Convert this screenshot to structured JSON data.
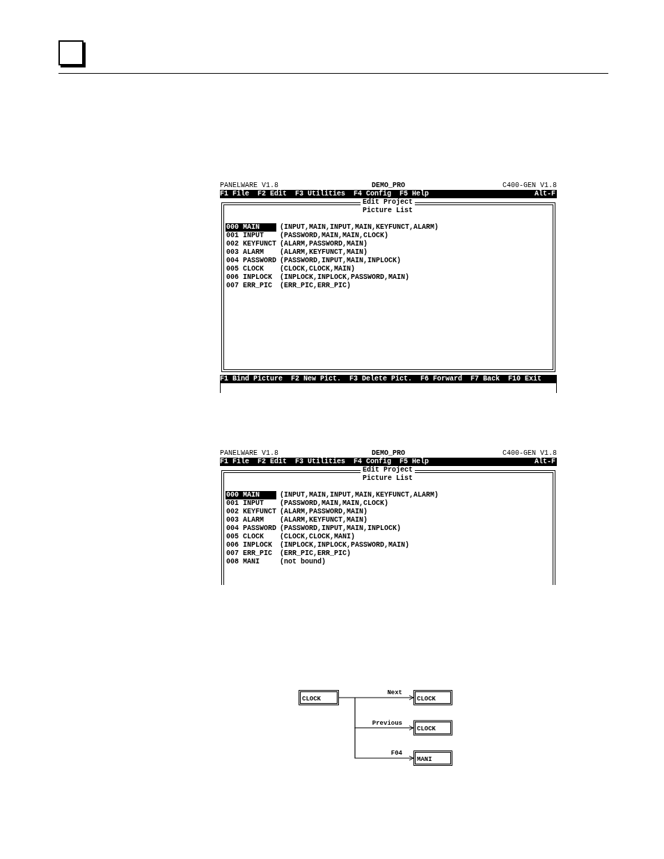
{
  "screens": [
    {
      "title": "PANELWARE V1.8",
      "project": "DEMO_PRO",
      "version": "C400-GEN V1.8",
      "menu": [
        "F1 File",
        "F2 Edit",
        "F3 Utilities",
        "F4 Config",
        "F5 Help"
      ],
      "menu_shortcut": "Alt-F",
      "frame_title": "Edit Project",
      "list_title": "Picture List",
      "pictures": [
        {
          "number": "000",
          "name": "MAIN",
          "links": "(INPUT,MAIN,INPUT,MAIN,KEYFUNCT,ALARM)",
          "selected": true
        },
        {
          "number": "001",
          "name": "INPUT",
          "links": "(PASSWORD,MAIN,MAIN,CLOCK)",
          "selected": false
        },
        {
          "number": "002",
          "name": "KEYFUNCT",
          "links": "(ALARM,PASSWORD,MAIN)",
          "selected": false
        },
        {
          "number": "003",
          "name": "ALARM",
          "links": "(ALARM,KEYFUNCT,MAIN)",
          "selected": false
        },
        {
          "number": "004",
          "name": "PASSWORD",
          "links": "(PASSWORD,INPUT,MAIN,INPLOCK)",
          "selected": false
        },
        {
          "number": "005",
          "name": "CLOCK",
          "links": "(CLOCK,CLOCK,MAIN)",
          "selected": false
        },
        {
          "number": "006",
          "name": "INPLOCK",
          "links": "(INPLOCK,INPLOCK,PASSWORD,MAIN)",
          "selected": false
        },
        {
          "number": "007",
          "name": "ERR_PIC",
          "links": "(ERR_PIC,ERR_PIC)",
          "selected": false
        }
      ],
      "function_keys": [
        "F1 Bind Picture",
        "F2 New Pict.",
        "F3 Delete Pict.",
        "F6 Forward",
        "F7 Back",
        "F10 Exit"
      ]
    },
    {
      "title": "PANELWARE V1.8",
      "project": "DEMO_PRO",
      "version": "C400-GEN V1.8",
      "menu": [
        "F1 File",
        "F2 Edit",
        "F3 Utilities",
        "F4 Config",
        "F5 Help"
      ],
      "menu_shortcut": "Alt-F",
      "frame_title": "Edit Project",
      "list_title": "Picture List",
      "pictures": [
        {
          "number": "000",
          "name": "MAIN",
          "links": "(INPUT,MAIN,INPUT,MAIN,KEYFUNCT,ALARM)",
          "selected": true
        },
        {
          "number": "001",
          "name": "INPUT",
          "links": "(PASSWORD,MAIN,MAIN,CLOCK)",
          "selected": false
        },
        {
          "number": "002",
          "name": "KEYFUNCT",
          "links": "(ALARM,PASSWORD,MAIN)",
          "selected": false
        },
        {
          "number": "003",
          "name": "ALARM",
          "links": "(ALARM,KEYFUNCT,MAIN)",
          "selected": false
        },
        {
          "number": "004",
          "name": "PASSWORD",
          "links": "(PASSWORD,INPUT,MAIN,INPLOCK)",
          "selected": false
        },
        {
          "number": "005",
          "name": "CLOCK",
          "links": "(CLOCK,CLOCK,MANI)",
          "selected": false
        },
        {
          "number": "006",
          "name": "INPLOCK",
          "links": "(INPLOCK,INPLOCK,PASSWORD,MAIN)",
          "selected": false
        },
        {
          "number": "007",
          "name": "ERR_PIC",
          "links": "(ERR_PIC,ERR_PIC)",
          "selected": false
        },
        {
          "number": "008",
          "name": "MANI",
          "links": "(not bound)",
          "selected": false
        }
      ]
    }
  ],
  "diagram": {
    "source": "CLOCK",
    "links": [
      {
        "label": "Next",
        "target": "CLOCK"
      },
      {
        "label": "Previous",
        "target": "CLOCK"
      },
      {
        "label": "F04",
        "target": "MANI"
      }
    ]
  }
}
